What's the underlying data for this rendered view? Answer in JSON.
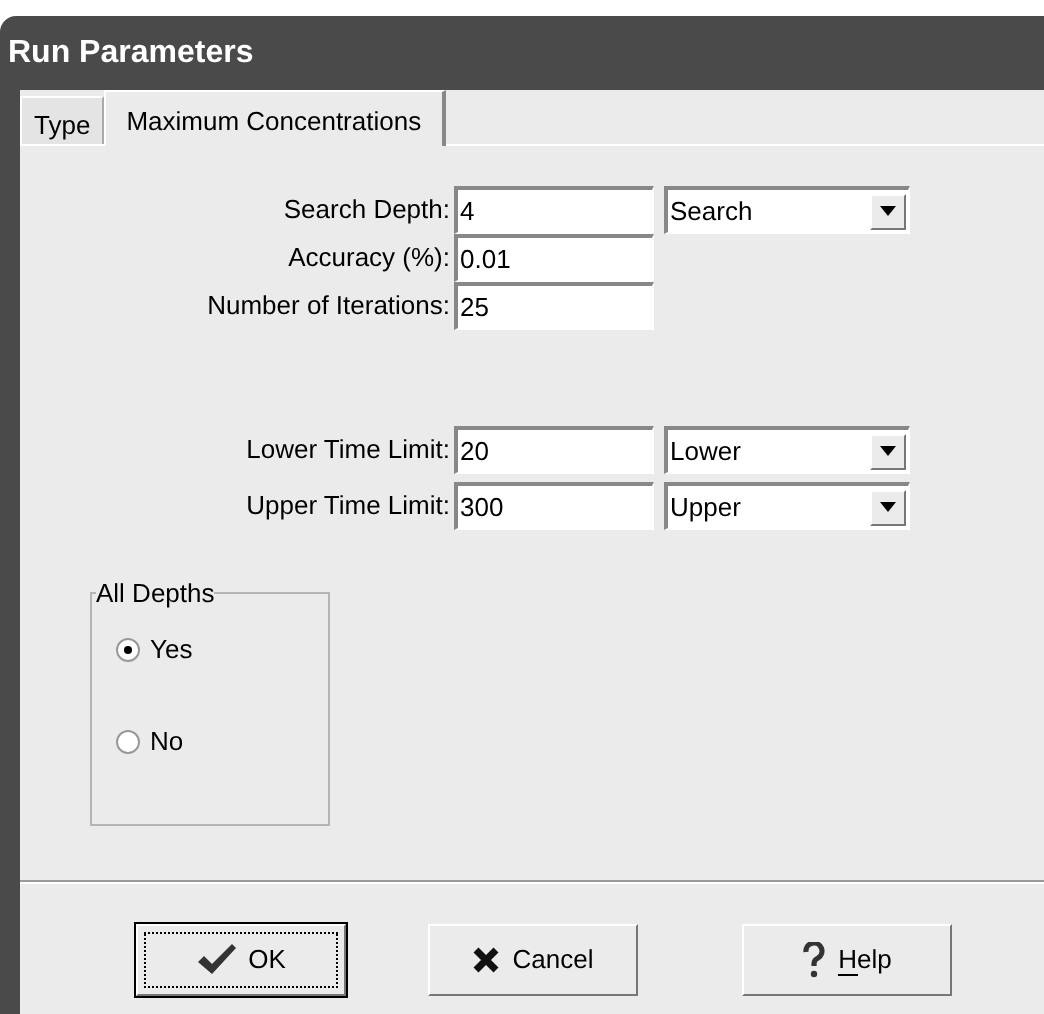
{
  "window": {
    "title": "Run Parameters"
  },
  "tabs": [
    {
      "label": "Type",
      "selected": false
    },
    {
      "label": "Maximum Concentrations",
      "selected": true
    }
  ],
  "field_groups": [
    [
      {
        "label": "Search Depth:",
        "value": "4",
        "dropdown": "Search"
      },
      {
        "label": "Accuracy (%):",
        "value": "0.01"
      },
      {
        "label": "Number of Iterations:",
        "value": "25"
      }
    ],
    [
      {
        "label": "Lower Time Limit:",
        "value": "20",
        "dropdown": "Lower"
      },
      {
        "label": "Upper Time Limit:",
        "value": "300",
        "dropdown": "Upper"
      }
    ]
  ],
  "group": {
    "title": "All Depths",
    "options": [
      {
        "label": "Yes",
        "selected": true
      },
      {
        "label": "No",
        "selected": false
      }
    ]
  },
  "buttons": [
    {
      "kind": "ok",
      "label": "OK",
      "default": true
    },
    {
      "kind": "cancel",
      "label": "Cancel",
      "default": false
    },
    {
      "kind": "help",
      "label": "Help",
      "default": false
    }
  ]
}
